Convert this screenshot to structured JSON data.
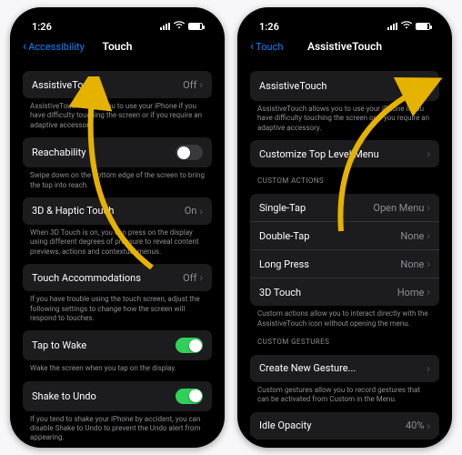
{
  "status": {
    "time": "1:26"
  },
  "left": {
    "back_label": "Accessibility",
    "title": "Touch",
    "rows": {
      "assistive": {
        "label": "AssistiveTouch",
        "value": "Off"
      },
      "assistive_foot": "AssistiveTouch allows you to use your iPhone if you have difficulty touching the screen or if you require an adaptive accessory.",
      "reach": {
        "label": "Reachability"
      },
      "reach_foot": "Swipe down on the bottom edge of the screen to bring the top into reach.",
      "haptic": {
        "label": "3D & Haptic Touch",
        "value": "On"
      },
      "haptic_foot": "When 3D Touch is on, you can press on the display using different degrees of pressure to reveal content previews, actions and contextual menus.",
      "accom": {
        "label": "Touch Accommodations",
        "value": "Off"
      },
      "accom_foot": "If you have trouble using the touch screen, adjust the following settings to change how the screen will respond to touches.",
      "tap": {
        "label": "Tap to Wake"
      },
      "tap_foot": "Wake the screen when you tap on the display.",
      "shake": {
        "label": "Shake to Undo"
      },
      "shake_foot": "If you tend to shake your iPhone by accident, you can disable Shake to Undo to prevent the Undo alert from appearing."
    }
  },
  "right": {
    "back_label": "Touch",
    "title": "AssistiveTouch",
    "rows": {
      "assistive": {
        "label": "AssistiveTouch"
      },
      "assistive_foot": "AssistiveTouch allows you to use your iPhone if you have difficulty touching the screen or if you require an adaptive accessory.",
      "customize": {
        "label": "Customize Top Level Menu"
      },
      "header_actions": "CUSTOM ACTIONS",
      "single": {
        "label": "Single-Tap",
        "value": "Open Menu"
      },
      "double": {
        "label": "Double-Tap",
        "value": "None"
      },
      "long": {
        "label": "Long Press",
        "value": "None"
      },
      "threeD": {
        "label": "3D Touch",
        "value": "Home"
      },
      "actions_foot": "Custom actions allow you to interact directly with the AssistiveTouch icon without opening the menu.",
      "header_gestures": "CUSTOM GESTURES",
      "gesture": {
        "label": "Create New Gesture..."
      },
      "gesture_foot": "Custom gestures allow you to record gestures that can be activated from Custom in the Menu.",
      "idle": {
        "label": "Idle Opacity",
        "value": "40%"
      }
    }
  }
}
